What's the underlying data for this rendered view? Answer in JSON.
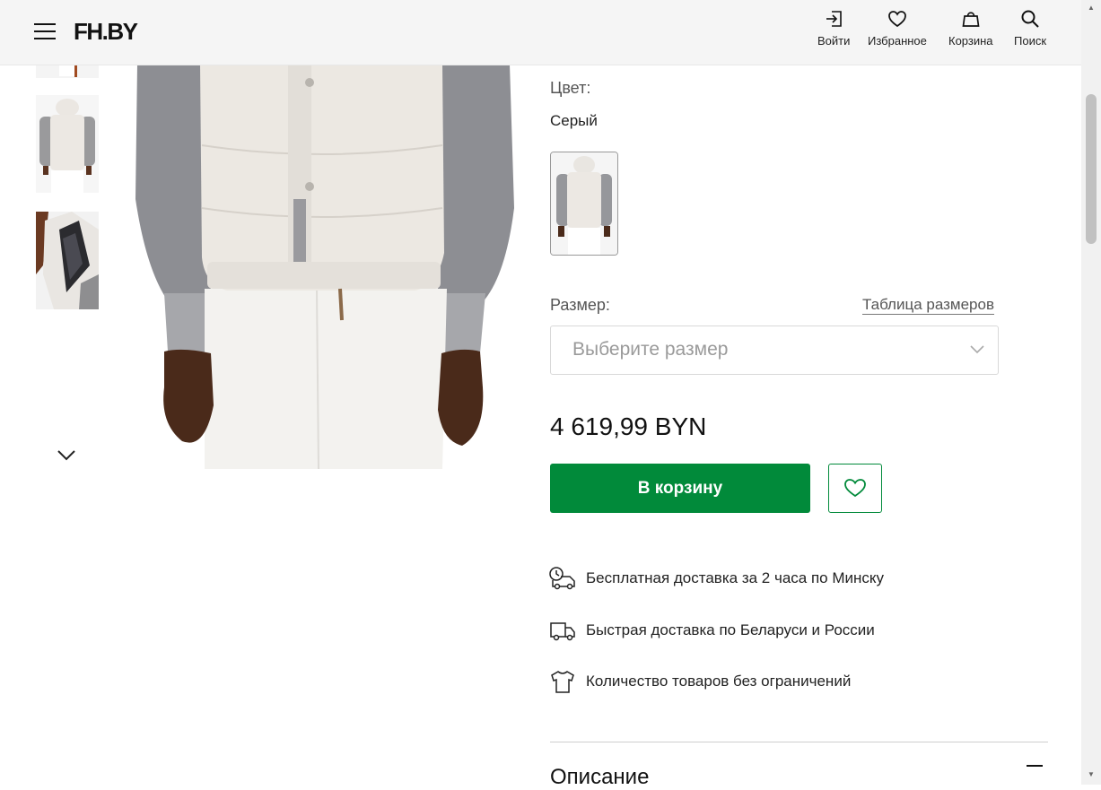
{
  "header": {
    "logo": "FH.BY",
    "nav": {
      "login": "Войти",
      "favorites": "Избранное",
      "cart": "Корзина",
      "search": "Поиск"
    }
  },
  "gallery": {
    "thumbnails": [
      "thumbnail-front",
      "thumbnail-back",
      "thumbnail-lining"
    ]
  },
  "product": {
    "color_label": "Цвет:",
    "color_value": "Серый",
    "size_label": "Размер:",
    "size_table_link": "Таблица размеров",
    "size_placeholder": "Выберите размер",
    "price": "4 619,99 BYN",
    "add_to_cart": "В корзину"
  },
  "features": [
    {
      "icon": "fast-delivery-icon",
      "text": "Бесплатная доставка за 2 часа по Минску"
    },
    {
      "icon": "truck-icon",
      "text": "Быстрая доставка по Беларуси и России"
    },
    {
      "icon": "tshirt-icon",
      "text": "Количество товаров без ограничений"
    }
  ],
  "description": {
    "title": "Описание"
  },
  "colors": {
    "accent": "#018a3a",
    "header_bg": "#f5f5f5"
  }
}
